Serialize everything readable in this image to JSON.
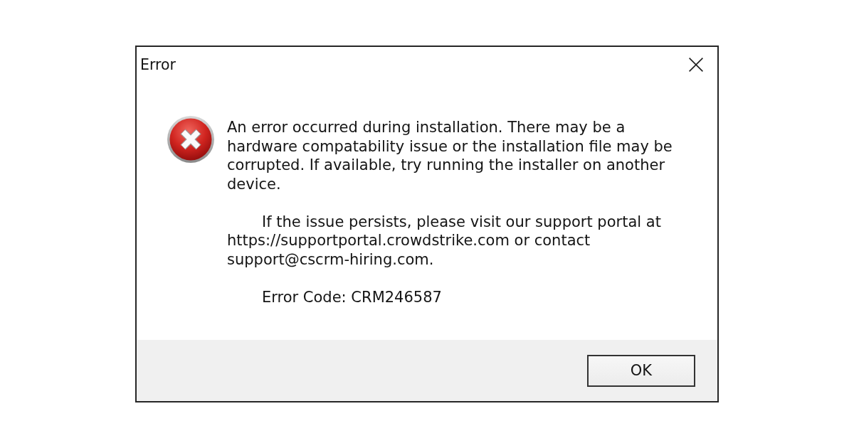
{
  "window": {
    "title": "Error"
  },
  "message": {
    "paragraphs": [
      {
        "indented": false,
        "lines": [
          "An error occurred during installation. There may be a",
          "hardware compatability issue or the installation file may be",
          "corrupted. If available, try running the installer on another",
          "device."
        ]
      },
      {
        "indented": true,
        "lines": [
          "If the issue persists, please visit our support portal at",
          "https://supportportal.crowdstrike.com or contact",
          "support@cscrm-hiring.com."
        ]
      },
      {
        "indented": true,
        "lines": [
          "Error Code: CRM246587"
        ]
      }
    ]
  },
  "buttons": [
    {
      "label": "OK",
      "focused": true
    }
  ]
}
